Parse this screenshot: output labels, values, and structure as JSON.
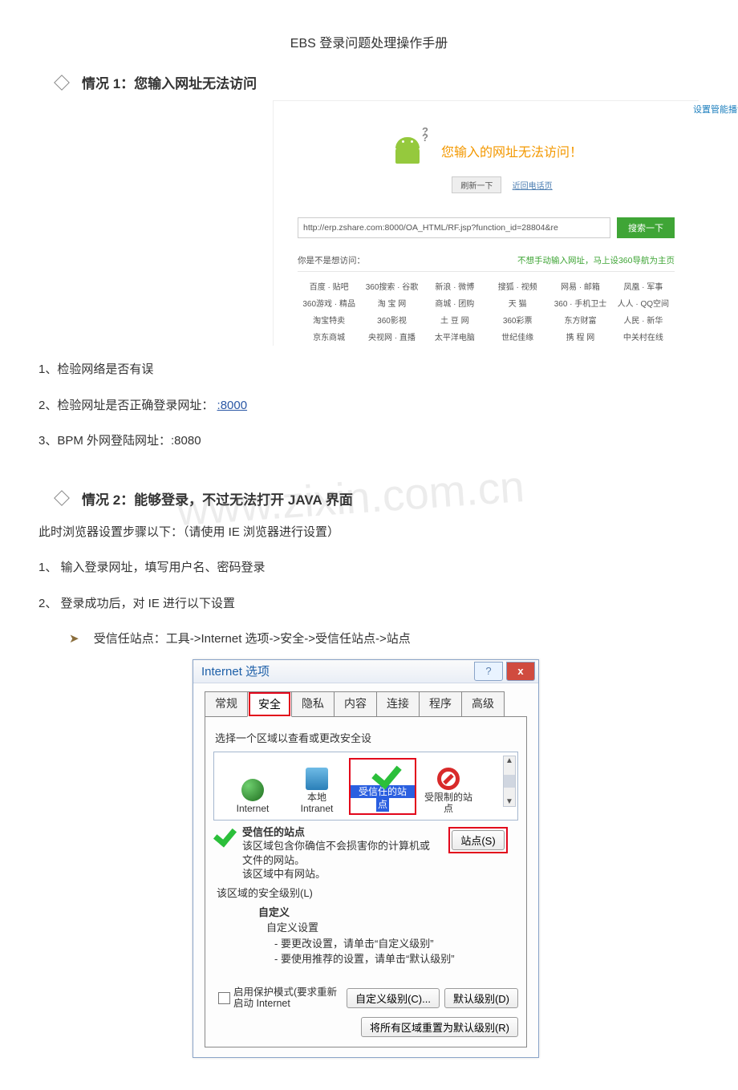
{
  "doc_title": "EBS 登录问题处理操作手册",
  "section1_title": "情况 1：您输入网址无法访问",
  "sc1": {
    "settings_link": "设置管能播误页",
    "hero_text": "您输入的网址无法访问！",
    "btn_refresh": "刷新一下",
    "link_back": "近回电话页",
    "url_value": "http://erp.zshare.com:8000/OA_HTML/RF.jsp?function_id=28804&re",
    "btn_search": "搜索一下",
    "ask_label": "你是不是想访问：",
    "tip_text": "不想手动输入网址，马上设360导航为主页",
    "grid": [
      [
        "百度 · 贴吧",
        "360搜索 · 谷歌",
        "新浪 · 微博",
        "搜狐 · 视频",
        "网易 · 邮箱",
        "凤凰 · 军事"
      ],
      [
        "360游戏 · 精品",
        "淘 宝 网",
        "商城 · 团购",
        "天 猫",
        "360 · 手机卫士",
        "人人 · QQ空间"
      ],
      [
        "淘宝特卖",
        "360影视",
        "土 豆 网",
        "360彩票",
        "东方财富",
        "人民 · 新华"
      ],
      [
        "京东商城",
        "央视网 · 直播",
        "太平洋电脑",
        "世纪佳缘",
        "携 程 网",
        "中关村在线"
      ]
    ]
  },
  "p1_1": "1、检验网络是否有误",
  "p1_2_pre": "2、检验网址是否正确登录网址：",
  "p1_2_link": ":8000",
  "p1_3": "3、BPM 外网登陆网址：:8080",
  "section2_title": "情况 2：能够登录，不过无法打开 JAVA 界面",
  "watermark": "www.zixin.com.cn",
  "p2_intro": "此时浏览器设置步骤以下：（请使用 IE 浏览器进行设置）",
  "p2_1": "1、 输入登录网址，填写用户名、密码登录",
  "p2_2": "2、 登录成功后，对 IE 进行以下设置",
  "p2_sub": "受信任站点：工具->Internet 选项->安全->受信任站点->站点",
  "dlg": {
    "title": "Internet 选项",
    "help_glyph": "?",
    "close_glyph": "x",
    "tabs": [
      "常规",
      "安全",
      "隐私",
      "内容",
      "连接",
      "程序",
      "高级"
    ],
    "zone_prompt": "选择一个区域以查看或更改安全设",
    "zones": {
      "internet": "Internet",
      "intranet_l1": "本地",
      "intranet_l2": "Intranet",
      "trusted_l1": "受信任的站",
      "trusted_l2": "点",
      "restricted_l1": "受限制的站",
      "restricted_l2": "点"
    },
    "sites_btn": "站点(S)",
    "trusted_title": "受信任的站点",
    "trusted_desc": "该区域包含你确信不会损害你的计算机或文件的网站。",
    "trusted_has": "该区域中有网站。",
    "level_label": "该区域的安全级别(L)",
    "custom": "自定义",
    "custom_settings": "自定义设置",
    "custom_line1": "- 要更改设置，请单击“自定义级别”",
    "custom_line2": "- 要使用推荐的设置，请单击“默认级别”",
    "protect_l1": "启用保护模式(要求重新",
    "protect_l2": "启动 Internet",
    "btn_custom": "自定义级别(C)...",
    "btn_default": "默认级别(D)",
    "btn_reset": "将所有区域重置为默认级别(R)"
  }
}
